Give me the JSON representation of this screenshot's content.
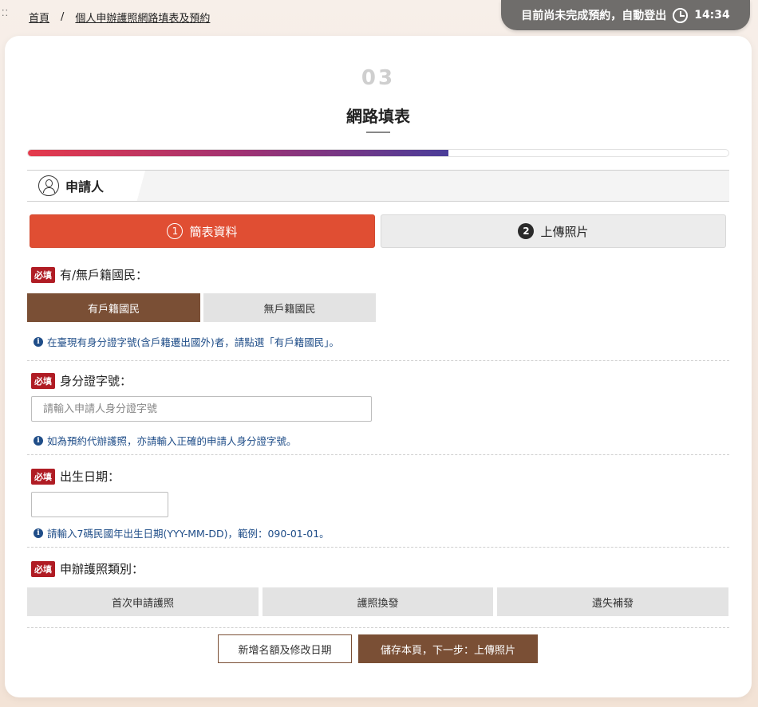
{
  "breadcrumb": {
    "home": "首頁",
    "separator": "/",
    "current": "個人申辦護照網路填表及預約"
  },
  "timer": {
    "message": "目前尚未完成預約，自動登出",
    "time": "14:34"
  },
  "step": {
    "number": "03",
    "title": "網路填表",
    "progress_percent": 60
  },
  "section": {
    "title": "申請人"
  },
  "subtabs": [
    {
      "num": "1",
      "label": "簡表資料",
      "active": true
    },
    {
      "num": "2",
      "label": "上傳照片",
      "active": false
    }
  ],
  "required_badge": "必填",
  "fields": {
    "household": {
      "label": "有/無戶籍國民：",
      "options": [
        "有戶籍國民",
        "無戶籍國民"
      ],
      "selected": "有戶籍國民",
      "hint": "在臺現有身分證字號(含戶籍遷出國外)者，請點選「有戶籍國民」。"
    },
    "id_number": {
      "label": "身分證字號：",
      "placeholder": "請輸入申請人身分證字號",
      "value": "",
      "hint": "如為預約代辦護照，亦請輸入正確的申請人身分證字號。"
    },
    "birth_date": {
      "label": "出生日期：",
      "value": "",
      "hint": "請輸入7碼民國年出生日期(YYY-MM-DD)，範例：090-01-01。"
    },
    "passport_type": {
      "label": "申辦護照類別：",
      "options": [
        "首次申請護照",
        "護照換發",
        "遺失補發"
      ]
    }
  },
  "footer": {
    "secondary_label": "新增名額及修改日期",
    "primary_label": "儲存本頁，下一步：上傳照片"
  },
  "colors": {
    "accent_red": "#e04e33",
    "brown": "#7a4f35",
    "required_red": "#b01c24",
    "hint_blue": "#1f4d88"
  }
}
